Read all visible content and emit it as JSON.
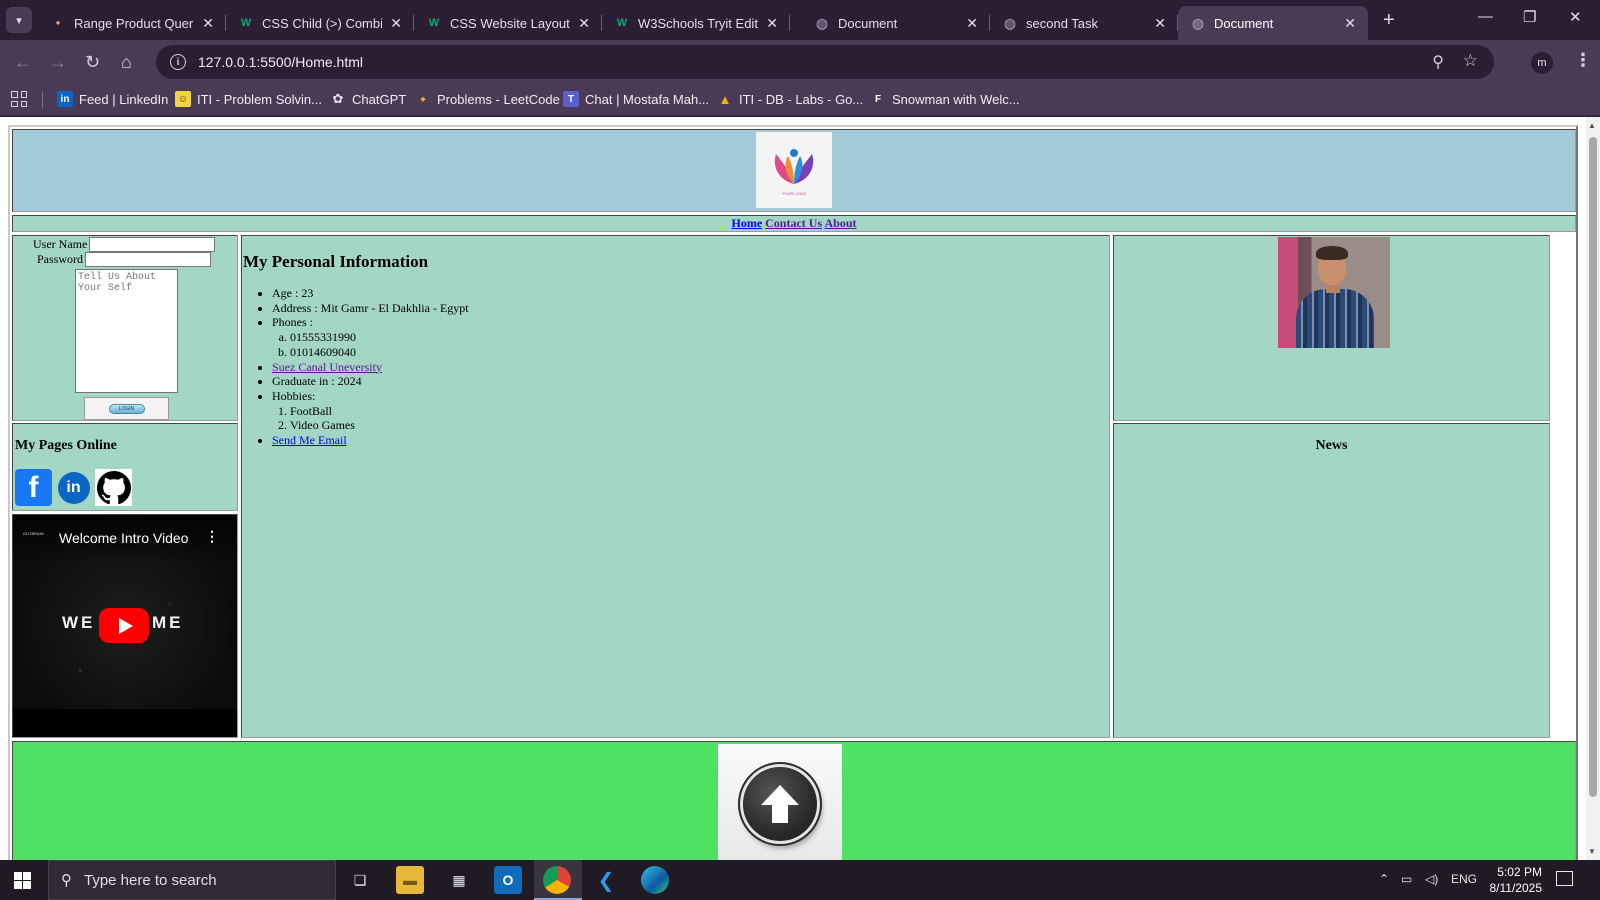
{
  "browser": {
    "tabs": [
      {
        "title": "Range Product Queries",
        "favicon": "leetcode-icon",
        "active": false
      },
      {
        "title": "CSS Child (>) Combinator",
        "favicon": "w3schools-icon",
        "active": false
      },
      {
        "title": "CSS Website Layout",
        "favicon": "w3schools-icon",
        "active": false
      },
      {
        "title": "W3Schools Tryit Editor",
        "favicon": "w3schools-icon",
        "active": false
      },
      {
        "title": "Document",
        "favicon": "globe-icon",
        "active": false
      },
      {
        "title": "second Task",
        "favicon": "globe-icon",
        "active": false
      },
      {
        "title": "Document",
        "favicon": "globe-icon",
        "active": true
      }
    ],
    "url": "127.0.0.1:5500/Home.html",
    "profile_initial": "m",
    "bookmarks": [
      {
        "label": "Feed | LinkedIn",
        "icon": "linkedin-icon"
      },
      {
        "label": "ITI - Problem Solvin...",
        "icon": "iti-icon"
      },
      {
        "label": "ChatGPT",
        "icon": "chatgpt-icon"
      },
      {
        "label": "Problems - LeetCode",
        "icon": "leetcode-icon"
      },
      {
        "label": "Chat | Mostafa Mah...",
        "icon": "teams-icon"
      },
      {
        "label": "ITI - DB - Labs - Go...",
        "icon": "google-drive-icon"
      },
      {
        "label": "Snowman with Welc...",
        "icon": "figma-icon"
      }
    ]
  },
  "page": {
    "logo_caption": "YOUR LOGO",
    "nav": {
      "home": "Home",
      "contact": "Contact Us",
      "about": "About"
    },
    "login": {
      "username_label": "User Name",
      "password_label": "Password",
      "textarea_placeholder": "Tell Us About Your Self",
      "button_label": "LOGIN"
    },
    "pages_online": {
      "title": "My Pages Online",
      "facebook_glyph": "f",
      "linkedin_glyph": "in"
    },
    "video": {
      "title": "Welcome Intro Video",
      "left_text": "WE",
      "right_text": "ME",
      "channel": "OUTBRAIN"
    },
    "personal": {
      "heading": "My Personal Information",
      "age": "Age : 23",
      "address": "Address : Mit Gamr - El Dakhlia - Egypt",
      "phones_label": "Phones :",
      "phones": [
        "01555331990",
        "01014609040"
      ],
      "university_link": "Suez Canal Uneversity",
      "graduate": "Graduate in : 2024",
      "hobbies_label": "Hobbies:",
      "hobbies": [
        "FootBall",
        "Video Games"
      ],
      "email_link": "Send Me Email"
    },
    "news": {
      "title": "News"
    }
  },
  "taskbar": {
    "search_placeholder": "Type here to search",
    "language": "ENG",
    "time": "5:02 PM",
    "date": "8/11/2025"
  },
  "colors": {
    "header_bg": "#a4ccd8",
    "content_bg": "#a3d6c5",
    "footer_bg": "#50e164",
    "browser_frame": "#2b1d33",
    "browser_toolbar": "#4b3a55"
  }
}
